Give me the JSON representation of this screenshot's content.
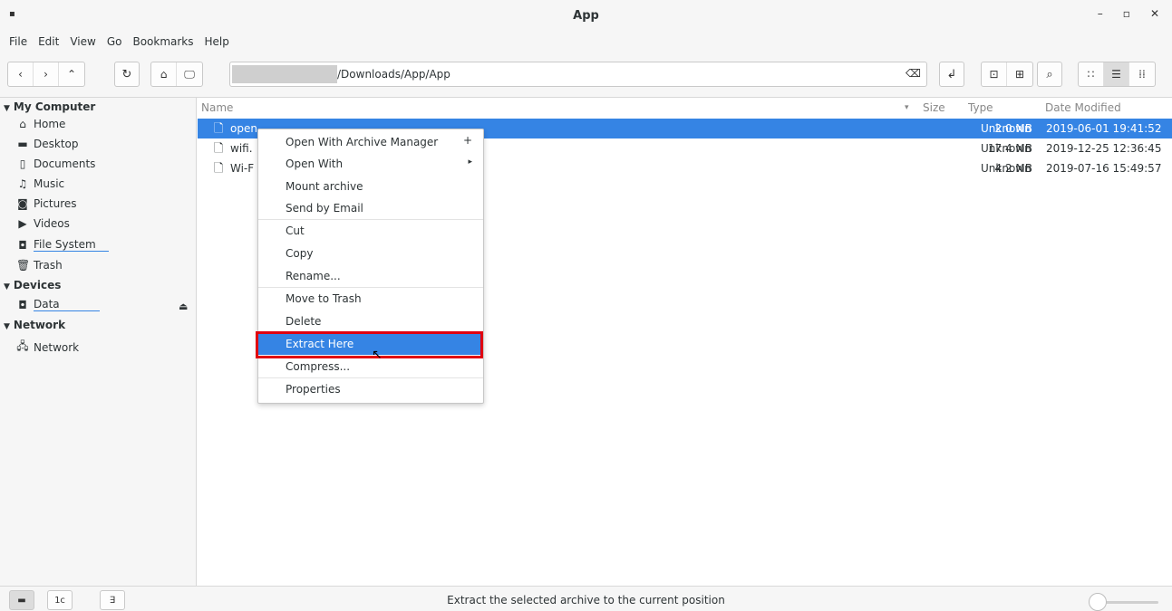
{
  "window": {
    "title": "App",
    "app_icon": "▪",
    "minimize": "–",
    "maximize": "▫",
    "close": "✕"
  },
  "menubar": [
    "File",
    "Edit",
    "View",
    "Go",
    "Bookmarks",
    "Help"
  ],
  "toolbar": {
    "back": "‹",
    "forward": "›",
    "up": "⌃",
    "reload": "↻",
    "home": "⌂",
    "computer": "🖵",
    "location_path": "/Downloads/App/App",
    "clear": "⌫",
    "open_terminal": "↲",
    "terminal": "⊡",
    "new_folder": "⊞",
    "search": "⌕",
    "view_icons": "∷",
    "view_list": "☰",
    "view_compact": "⁞⁞"
  },
  "sidebar": {
    "my_computer": "My Computer",
    "places": [
      {
        "label": "Home",
        "icon": "⌂"
      },
      {
        "label": "Desktop",
        "icon": "▬"
      },
      {
        "label": "Documents",
        "icon": "▯"
      },
      {
        "label": "Music",
        "icon": "♫"
      },
      {
        "label": "Pictures",
        "icon": "◙"
      },
      {
        "label": "Videos",
        "icon": "▶"
      },
      {
        "label": "File System",
        "icon": "◘"
      },
      {
        "label": "Trash",
        "icon": "🗑"
      }
    ],
    "devices": "Devices",
    "device_items": [
      {
        "label": "Data",
        "icon": "◘"
      }
    ],
    "eject": "⏏",
    "network": "Network",
    "network_items": [
      {
        "label": "Network",
        "icon": "🖧"
      }
    ]
  },
  "columns": {
    "name": "Name",
    "sort": "▾",
    "size": "Size",
    "type": "Type",
    "date": "Date Modified"
  },
  "files": [
    {
      "name": "open",
      "size": "2.0 MB",
      "type": "Unknown",
      "date": "2019-06-01 19:41:52"
    },
    {
      "name": "wifi.",
      "size": "17.4 MB",
      "type": "Unknown",
      "date": "2019-12-25 12:36:45"
    },
    {
      "name": "Wi-F",
      "size": "4.2 MB",
      "type": "Unknown",
      "date": "2019-07-16 15:49:57"
    }
  ],
  "context_menu": {
    "open_with_archive": "Open With Archive Manager",
    "open_with": "Open With",
    "mount": "Mount archive",
    "send_email": "Send by Email",
    "cut": "Cut",
    "copy": "Copy",
    "rename": "Rename...",
    "trash": "Move to Trash",
    "delete": "Delete",
    "extract": "Extract Here",
    "compress": "Compress...",
    "properties": "Properties",
    "plus": "+",
    "submenu": "▸"
  },
  "status": {
    "text": "Extract the selected archive to the current position",
    "btn_places": "▬",
    "btn_tree": "1c",
    "btn_close": "∃"
  }
}
